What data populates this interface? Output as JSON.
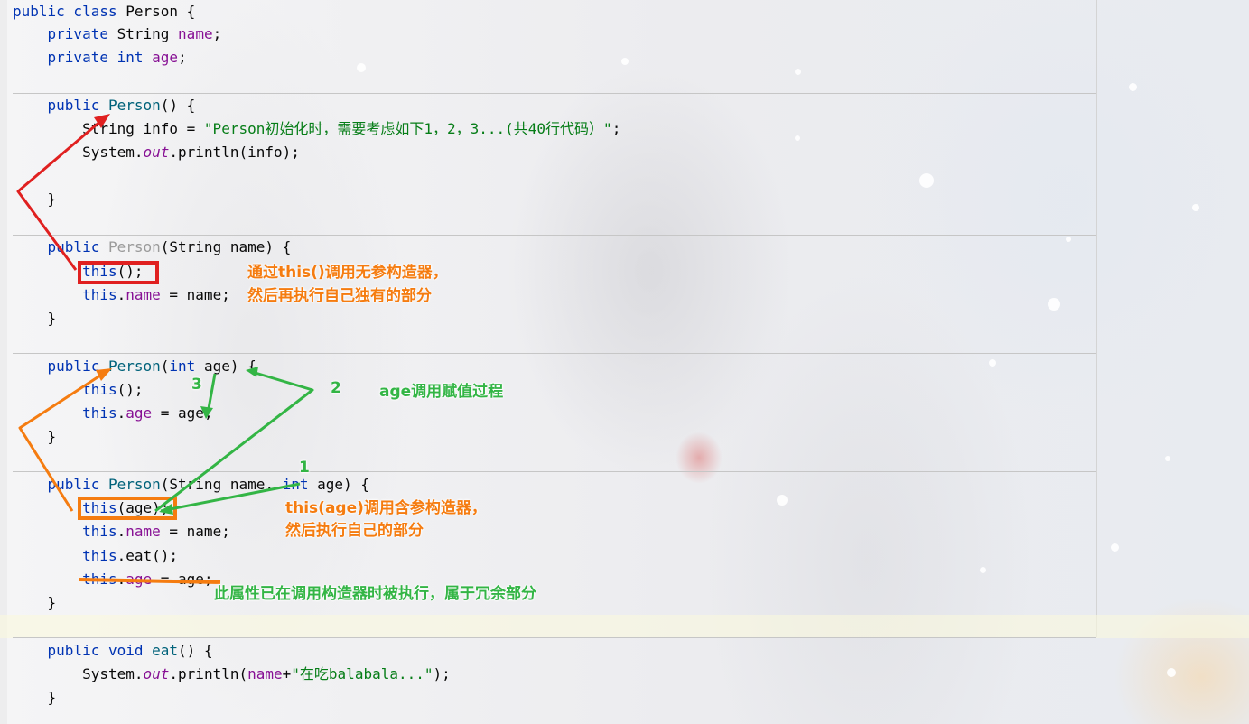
{
  "code": {
    "class_decl": {
      "kw": "public class",
      "name": "Person",
      "brace": "{"
    },
    "field_name": {
      "kw": "private",
      "type": "String",
      "name": "name",
      "end": ";"
    },
    "field_age": {
      "kw": "private",
      "type": "int",
      "name": "age",
      "end": ";"
    },
    "ctor1": {
      "sig_kw": "public",
      "sig_name": "Person",
      "sig_rest": "() {",
      "info_type": "String info = ",
      "info_string": "\"Person初始化时，需要考虑如下1，2，3...(共40行代码）\"",
      "info_end": ";",
      "print_pre": "System.",
      "print_out": "out",
      "print_post": ".println(info);",
      "close": "}"
    },
    "ctor2": {
      "sig_kw": "public",
      "sig_name": "Person",
      "sig_rest": "(String name) {",
      "call_kw": "this",
      "call_rest": "();",
      "assign_kw": "this",
      "assign_dot": ".",
      "assign_field": "name",
      "assign_rest": " = name;",
      "close": "}"
    },
    "ctor3": {
      "sig_kw": "public",
      "sig_name": "Person",
      "sig_open": "(",
      "sig_int": "int",
      "sig_rest": " age) {",
      "call_kw": "this",
      "call_rest": "();",
      "assign_kw": "this",
      "assign_dot": ".",
      "assign_field": "age",
      "assign_rest": " = age;",
      "close": "}"
    },
    "ctor4": {
      "sig_kw": "public",
      "sig_name": "Person",
      "sig_open": "(String name, ",
      "sig_int": "int",
      "sig_rest": " age) {",
      "call_kw": "this",
      "call_rest": "(age);",
      "assign_kw": "this",
      "assign_dot": ".",
      "assign_field": "name",
      "assign_rest": " = name;",
      "eat_kw": "this",
      "eat_rest": ".eat();",
      "dup_kw": "this",
      "dup_dot": ".",
      "dup_field": "age",
      "dup_rest": " = age;",
      "close": "}"
    },
    "eat": {
      "sig_kw": "public void",
      "sig_name": "eat",
      "sig_rest": "() {",
      "print_pre": "System.",
      "print_out": "out",
      "print_mid": ".println(",
      "print_field": "name",
      "print_plus": "+",
      "print_string": "\"在吃balabala...\"",
      "print_end": ");",
      "close": "}"
    }
  },
  "annotations": {
    "note_this_call_1": "通过this()调用无参构造器，",
    "note_this_call_2": "然后再执行自己独有的部分",
    "note_age_assign": "age调用赋值过程",
    "note_this_age_1": "this(age)调用含参构造器，",
    "note_this_age_2": "然后执行自己的部分",
    "note_redundant": "此属性已在调用构造器时被执行，属于冗余部分",
    "step_1": "1",
    "step_2": "2",
    "step_3": "3"
  },
  "colors": {
    "keyword": "#0033b3",
    "field": "#871094",
    "method": "#00627a",
    "string": "#067d17",
    "annotation_orange": "#f57c10",
    "annotation_green": "#33b545",
    "arrow_red": "#e02020"
  }
}
